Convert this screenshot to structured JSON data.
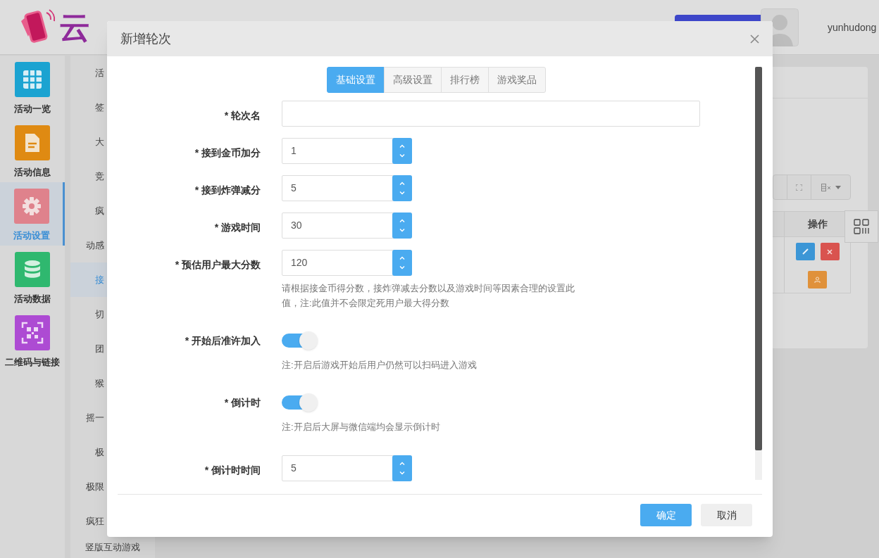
{
  "header": {
    "logo": "云",
    "user": "yunhudong"
  },
  "sidebar": [
    {
      "label": "活动一览",
      "color": "#1ba3d1",
      "selected": false
    },
    {
      "label": "活动信息",
      "color": "#df8a12",
      "selected": false
    },
    {
      "label": "活动设置",
      "color": "#df828c",
      "selected": true
    },
    {
      "label": "活动数据",
      "color": "#2fb86f",
      "selected": false
    },
    {
      "label": "二维码与链接",
      "color": "#ad4bd3",
      "selected": false
    }
  ],
  "submenu": [
    {
      "label": "活",
      "selected": false
    },
    {
      "label": "签",
      "selected": false
    },
    {
      "label": "大",
      "selected": false
    },
    {
      "label": "竞",
      "selected": false
    },
    {
      "label": "疯",
      "selected": false
    },
    {
      "label": "动感",
      "selected": false
    },
    {
      "label": "接",
      "selected": true
    },
    {
      "label": "切",
      "selected": false
    },
    {
      "label": "团",
      "selected": false
    },
    {
      "label": "猴",
      "selected": false
    },
    {
      "label": "摇一",
      "selected": false
    },
    {
      "label": "极",
      "selected": false
    },
    {
      "label": "极限",
      "selected": false
    },
    {
      "label": "疯狂",
      "selected": false
    },
    {
      "label": "竖版互动游戏",
      "selected": false
    }
  ],
  "table": {
    "column": "操作"
  },
  "modal": {
    "title": "新增轮次",
    "tabs": [
      {
        "label": "基础设置",
        "selected": true
      },
      {
        "label": "高级设置",
        "selected": false
      },
      {
        "label": "排行榜",
        "selected": false
      },
      {
        "label": "游戏奖品",
        "selected": false
      }
    ],
    "fields": [
      {
        "kind": "text",
        "label": "* 轮次名"
      },
      {
        "kind": "number",
        "label": "* 接到金币加分",
        "value": "1"
      },
      {
        "kind": "number",
        "label": "* 接到炸弹减分",
        "value": "5"
      },
      {
        "kind": "number",
        "label": "* 游戏时间",
        "value": "30"
      },
      {
        "kind": "number",
        "label": "* 预估用户最大分数",
        "value": "120",
        "help": "请根据接金币得分数，接炸弹减去分数以及游戏时间等因素合理的设置此值，注:此值并不会限定死用户最大得分数"
      },
      {
        "kind": "switch",
        "label": "* 开始后准许加入",
        "on": true,
        "help": "注:开启后游戏开始后用户仍然可以扫码进入游戏"
      },
      {
        "kind": "switch",
        "label": "* 倒计时",
        "on": true,
        "help": "注:开启后大屏与微信端均会显示倒计时"
      },
      {
        "kind": "number",
        "label": "* 倒计时时间",
        "value": "5"
      }
    ],
    "buttons": [
      {
        "label": "确定",
        "kind": "primary"
      },
      {
        "label": "取消",
        "kind": "default"
      }
    ]
  }
}
